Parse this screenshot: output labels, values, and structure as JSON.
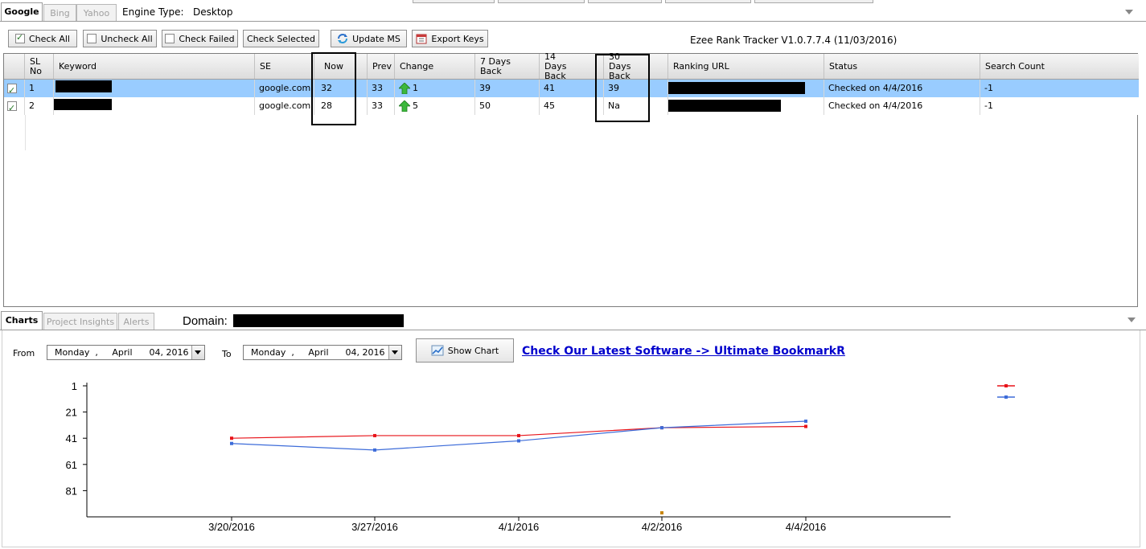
{
  "engine_tabs": [
    {
      "label": "Google",
      "active": true
    },
    {
      "label": "Bing",
      "active": false
    },
    {
      "label": "Yahoo",
      "active": false
    }
  ],
  "engine_type": {
    "label": "Engine Type:",
    "value": "Desktop"
  },
  "toolbar": {
    "check_all": "Check All",
    "uncheck_all": "Uncheck All",
    "check_failed": "Check Failed",
    "check_selected": "Check Selected",
    "update_ms": "Update MS",
    "export_keys": "Export Keys"
  },
  "app_title": "Ezee Rank Tracker V1.0.7.7.4 (11/03/2016)",
  "grid": {
    "headers": {
      "sl_no": "SL No",
      "keyword": "Keyword",
      "se": "SE",
      "now": "Now",
      "prev": "Prev",
      "change": "Change",
      "days7": "7 Days Back",
      "days14": "14 Days Back",
      "days30": "30 Days Back",
      "ranking_url": "Ranking URL",
      "status": "Status",
      "search_count": "Search Count"
    },
    "rows": [
      {
        "checked": true,
        "sl": "1",
        "se": "google.com",
        "now": "32",
        "prev": "33",
        "change": "1",
        "days7": "39",
        "days14": "41",
        "days30": "39",
        "status": "Checked on 4/4/2016",
        "search_count": "-1",
        "selected": true
      },
      {
        "checked": true,
        "sl": "2",
        "se": "google.com",
        "now": "28",
        "prev": "33",
        "change": "5",
        "days7": "50",
        "days14": "45",
        "days30": "Na",
        "status": "Checked on 4/4/2016",
        "search_count": "-1",
        "selected": false
      }
    ]
  },
  "bottom_tabs": [
    {
      "label": "Charts",
      "active": true
    },
    {
      "label": "Project Insights",
      "active": false
    },
    {
      "label": "Alerts",
      "active": false
    }
  ],
  "domain_label": "Domain:",
  "date_range": {
    "from_label": "From",
    "from_value": "Monday  ,     April      04, 2016",
    "to_label": "To",
    "to_value": "Monday  ,     April      04, 2016"
  },
  "show_chart": "Show Chart",
  "promo_link": "Check Our Latest Software -> Ultimate BookmarkR",
  "colors": {
    "selected_row": "#99ccff",
    "series1": "#e8141a",
    "series2": "#3d6cd9",
    "highlight_box": "#000000"
  },
  "chart_data": {
    "type": "line",
    "x": [
      "3/20/2016",
      "3/27/2016",
      "4/1/2016",
      "4/2/2016",
      "4/4/2016"
    ],
    "yticks": [
      1,
      21,
      41,
      61,
      81
    ],
    "ylim": [
      1,
      101
    ],
    "y_inverted": true,
    "legend_placement": "top-right",
    "series": [
      {
        "values": [
          41,
          39,
          39,
          33,
          32
        ],
        "color": "#e8141a"
      },
      {
        "values": [
          45,
          50,
          43,
          33,
          28
        ],
        "color": "#3d6cd9"
      }
    ]
  }
}
